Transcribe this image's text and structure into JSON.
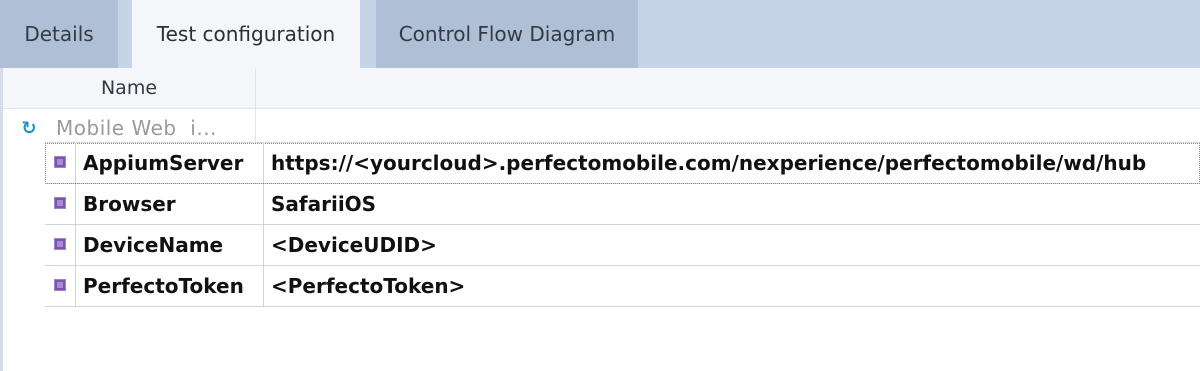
{
  "tabs": [
    {
      "label": "Details",
      "active": false
    },
    {
      "label": "Test configuration",
      "active": true
    },
    {
      "label": "Control Flow Diagram",
      "active": false
    }
  ],
  "grid": {
    "name_header": "Name",
    "group": {
      "icon": "refresh-icon",
      "label": "Mobile Web  i..."
    },
    "properties": [
      {
        "name": "AppiumServer",
        "value": "https://<yourcloud>.perfectomobile.com/nexperience/perfectomobile/wd/hub"
      },
      {
        "name": "Browser",
        "value": "SafariiOS"
      },
      {
        "name": "DeviceName",
        "value": "<DeviceUDID>"
      },
      {
        "name": "PerfectoToken",
        "value": "<PerfectoToken>"
      }
    ]
  },
  "colors": {
    "tabbar": "#c5d3e6",
    "active_tab": "#f4f6f9",
    "inactive_tab": "#aebfd6",
    "refresh_icon": "#1a93c6",
    "property_bullet": "#7b52ae"
  }
}
